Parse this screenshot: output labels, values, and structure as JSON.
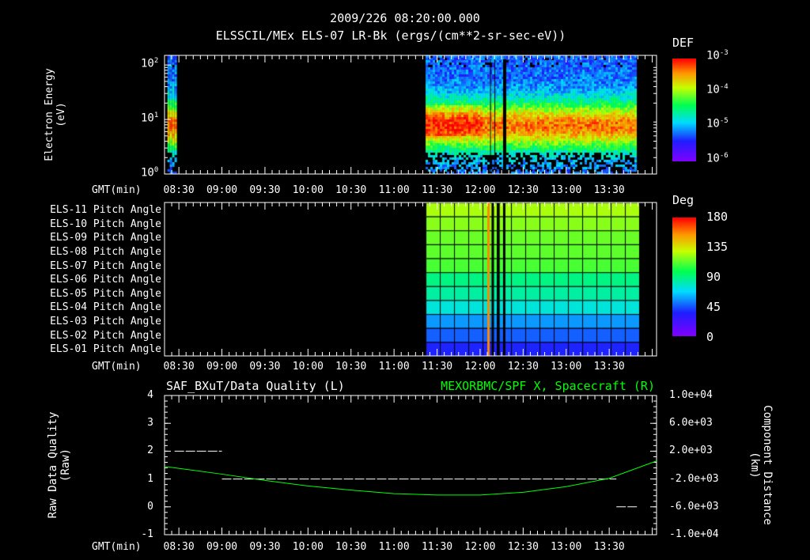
{
  "header": {
    "title": "2009/226 08:20:00.000",
    "subtitle": "ELSSCIL/MEx ELS-07 LR-Bk  (ergs/(cm**2-sr-sec-eV))"
  },
  "time_axis": {
    "label": "GMT(min)",
    "start": "08:20",
    "end": "14:03",
    "ticks": [
      "08:30",
      "09:00",
      "09:30",
      "10:00",
      "10:30",
      "11:00",
      "11:30",
      "12:00",
      "12:30",
      "13:00",
      "13:30"
    ]
  },
  "chart_data": [
    {
      "type": "heatmap",
      "name": "energy-spectrogram",
      "ylabel": "Electron Energy\n(eV)",
      "yscale": "log",
      "ylim": [
        1,
        150
      ],
      "yticks": [
        "10^0",
        "10^1",
        "10^2"
      ],
      "colorbar": {
        "title": "DEF",
        "scale": "log",
        "range": [
          1e-06,
          0.001
        ],
        "ticks": [
          "10^-3",
          "10^-4",
          "10^-5",
          "10^-6"
        ]
      },
      "data_intervals": [
        [
          "08:22",
          "08:27"
        ],
        [
          "11:22",
          "13:48"
        ]
      ],
      "peak_energy_band_eV": [
        4,
        30
      ]
    },
    {
      "type": "heatmap",
      "name": "pitch-angle",
      "rows": [
        "ELS-11 Pitch Angle",
        "ELS-10 Pitch Angle",
        "ELS-09 Pitch Angle",
        "ELS-08 Pitch Angle",
        "ELS-07 Pitch Angle",
        "ELS-06 Pitch Angle",
        "ELS-05 Pitch Angle",
        "ELS-04 Pitch Angle",
        "ELS-03 Pitch Angle",
        "ELS-02 Pitch Angle",
        "ELS-01 Pitch Angle"
      ],
      "row_angles_deg": [
        110,
        105,
        100,
        98,
        95,
        90,
        85,
        75,
        65,
        55,
        45
      ],
      "colorbar": {
        "title": "Deg",
        "range": [
          0,
          180
        ],
        "ticks": [
          "180",
          "135",
          "90",
          "45",
          "0"
        ]
      },
      "data_interval": [
        "11:22",
        "13:48"
      ]
    },
    {
      "type": "line",
      "name": "data-quality-and-position",
      "left": {
        "title": "SAF_BXuT/Data Quality (L)",
        "ylabel": "Raw Data Quality\n(Raw)",
        "ylim": [
          -1,
          4
        ],
        "ticks": [
          "4",
          "3",
          "2",
          "1",
          "0",
          "-1"
        ],
        "segments": [
          {
            "from": "08:27",
            "to": "09:00",
            "value": 2
          },
          {
            "from": "09:00",
            "to": "13:35",
            "value": 1
          },
          {
            "from": "13:35",
            "to": "13:50",
            "value": 0
          }
        ]
      },
      "right": {
        "title": "MEXORBMC/SPF X, Spacecraft (R)",
        "ylabel": "Component Distance\n(km)",
        "ylim": [
          -10000,
          10000
        ],
        "ticks": [
          "1.0e+04",
          "6.0e+03",
          "2.0e+03",
          "-2.0e+03",
          "-6.0e+03",
          "-1.0e+04"
        ],
        "color": "#00ff00",
        "x": [
          "08:20",
          "09:00",
          "09:30",
          "10:00",
          "10:30",
          "11:00",
          "11:30",
          "12:00",
          "12:30",
          "13:00",
          "13:30",
          "14:03"
        ],
        "y": [
          -200,
          -1300,
          -2200,
          -3000,
          -3600,
          -4100,
          -4300,
          -4300,
          -3900,
          -3100,
          -1900,
          600
        ]
      }
    }
  ]
}
